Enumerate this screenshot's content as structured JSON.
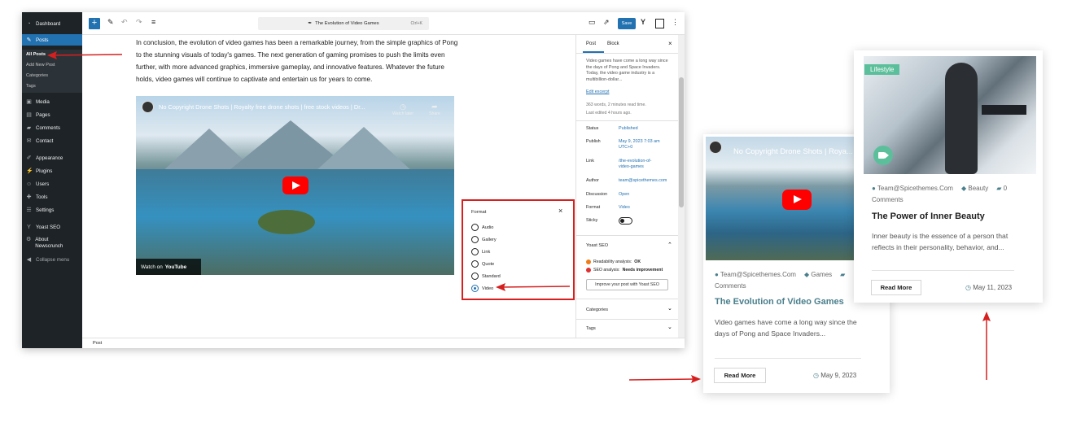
{
  "sidebar": {
    "items": [
      {
        "label": "Dashboard",
        "icon": "dashboard-icon"
      },
      {
        "label": "Posts",
        "icon": "pin-icon"
      },
      {
        "label": "Media",
        "icon": "media-icon"
      },
      {
        "label": "Pages",
        "icon": "pages-icon"
      },
      {
        "label": "Comments",
        "icon": "comments-icon"
      },
      {
        "label": "Contact",
        "icon": "mail-icon"
      },
      {
        "label": "Appearance",
        "icon": "brush-icon"
      },
      {
        "label": "Plugins",
        "icon": "plugin-icon"
      },
      {
        "label": "Users",
        "icon": "users-icon"
      },
      {
        "label": "Tools",
        "icon": "wrench-icon"
      },
      {
        "label": "Settings",
        "icon": "settings-icon"
      },
      {
        "label": "Yoast SEO",
        "icon": "yoast-icon"
      },
      {
        "label": "About Newscrunch",
        "icon": "gear-icon"
      },
      {
        "label": "Collapse menu",
        "icon": "collapse-icon"
      }
    ],
    "posts_submenu": [
      "All Posts",
      "Add New Post",
      "Categories",
      "Tags"
    ]
  },
  "toolbar": {
    "add": "+",
    "doc_title": "The Evolution of Video Games",
    "shortcut": "Ctrl+K",
    "save": "Save"
  },
  "editor": {
    "paragraph": "In conclusion, the evolution of video games has been a remarkable journey, from the simple graphics of Pong to the stunning visuals of today's games. The next generation of gaming promises to push the limits even further, with more advanced graphics, immersive gameplay, and innovative features. Whatever the future holds, video games will continue to captivate and entertain us for years to come.",
    "video_title": "No Copyright Drone Shots | Royalty free drone shots | free stock videos | Dr...",
    "watch_later": "Watch later",
    "share": "Share",
    "watch_on": "Watch on",
    "youtube": "YouTube",
    "statusbar": "Post"
  },
  "settings": {
    "tab_post": "Post",
    "tab_block": "Block",
    "excerpt": "Video games have come a long way since the days of Pong and Space Invaders. Today, the video game industry is a multibillion-dollar...",
    "edit_excerpt": "Edit excerpt",
    "word_count": "363 words, 2 minutes read time.",
    "last_edited": "Last edited 4 hours ago.",
    "rows": [
      {
        "label": "Status",
        "value": "Published"
      },
      {
        "label": "Publish",
        "value": "May 9, 2023 7:03 am UTC+0"
      },
      {
        "label": "Link",
        "value": "/the-evolution-of-video-games"
      },
      {
        "label": "Author",
        "value": "team@spicethemes.com"
      },
      {
        "label": "Discussion",
        "value": "Open"
      },
      {
        "label": "Format",
        "value": "Video"
      },
      {
        "label": "Sticky",
        "value": ""
      }
    ],
    "yoast_title": "Yoast SEO",
    "readability_label": "Readability analysis:",
    "readability_value": "OK",
    "seo_label": "SEO analysis:",
    "seo_value": "Needs improvement",
    "improve_button": "Improve your post with Yoast SEO",
    "categories": "Categories",
    "tags": "Tags"
  },
  "format_popover": {
    "title": "Format",
    "close": "×",
    "options": [
      "Audio",
      "Gallery",
      "Link",
      "Quote",
      "Standard",
      "Video"
    ],
    "selected": "Video"
  },
  "card_video": {
    "video_title": "No Copyright Drone Shots | Roya...",
    "author": "Team@Spicethemes.Com",
    "category": "Games",
    "comments": "Comments",
    "title": "The Evolution of Video Games",
    "excerpt": "Video games have come a long way since the days of Pong and Space Invaders...",
    "read_more": "Read More",
    "date": "May 9, 2023"
  },
  "card_lifestyle": {
    "badge": "Lifestyle",
    "author": "Team@Spicethemes.Com",
    "category": "Beauty",
    "comment_count": "0",
    "comments": "Comments",
    "title": "The Power of Inner Beauty",
    "excerpt": "Inner beauty is the essence of a person that reflects in their personality, behavior, and...",
    "read_more": "Read More",
    "date": "May 11, 2023"
  },
  "colors": {
    "wp_blue": "#2271b1",
    "wp_dark": "#1d2327",
    "highlight_red": "#d61f1f",
    "card_title_teal": "#4a7f8c",
    "youtube_red": "#ff0000",
    "lifestyle_badge": "#5bbf9b"
  }
}
